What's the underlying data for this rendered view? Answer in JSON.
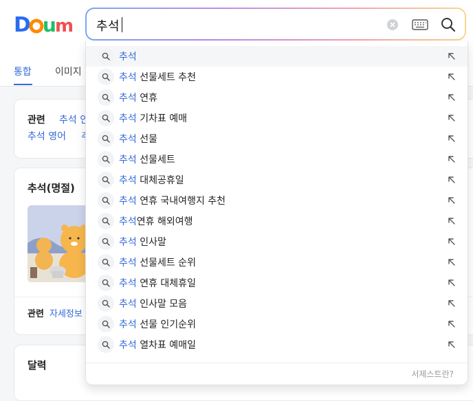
{
  "logo": {
    "text": "Daum"
  },
  "search": {
    "query": "추석"
  },
  "tabs": [
    {
      "label": "통합"
    },
    {
      "label": "이미지"
    }
  ],
  "related_card": {
    "label": "관련",
    "links": [
      "추석 인",
      "추석 영어",
      "추"
    ]
  },
  "holiday_card": {
    "title": "추석(명절)",
    "footer_label": "관련",
    "footer_link": "자세정보"
  },
  "calendar_card": {
    "title": "달력"
  },
  "suggestions": [
    {
      "kw": "추석",
      "rest": ""
    },
    {
      "kw": "추석",
      "rest": " 선물세트 추천"
    },
    {
      "kw": "추석",
      "rest": " 연휴"
    },
    {
      "kw": "추석",
      "rest": " 기차표 예매"
    },
    {
      "kw": "추석",
      "rest": " 선물"
    },
    {
      "kw": "추석",
      "rest": " 선물세트"
    },
    {
      "kw": "추석",
      "rest": " 대체공휴일"
    },
    {
      "kw": "추석",
      "rest": " 연휴 국내여행지 추천"
    },
    {
      "kw": "추석",
      "rest": "연휴 해외여행"
    },
    {
      "kw": "추석",
      "rest": " 인사말"
    },
    {
      "kw": "추석",
      "rest": " 선물세트 순위"
    },
    {
      "kw": "추석",
      "rest": " 연휴 대체휴일"
    },
    {
      "kw": "추석",
      "rest": " 인사말 모음"
    },
    {
      "kw": "추석",
      "rest": " 선물 인기순위"
    },
    {
      "kw": "추석",
      "rest": " 열차표 예매일"
    }
  ],
  "dropdown_footer": "서제스트란?",
  "colors": {
    "accent": "#3369d8",
    "logo_blue": "#2a6cf0",
    "logo_orange": "#ff8a00",
    "logo_green": "#1fbf69",
    "logo_red": "#f04f4f"
  }
}
